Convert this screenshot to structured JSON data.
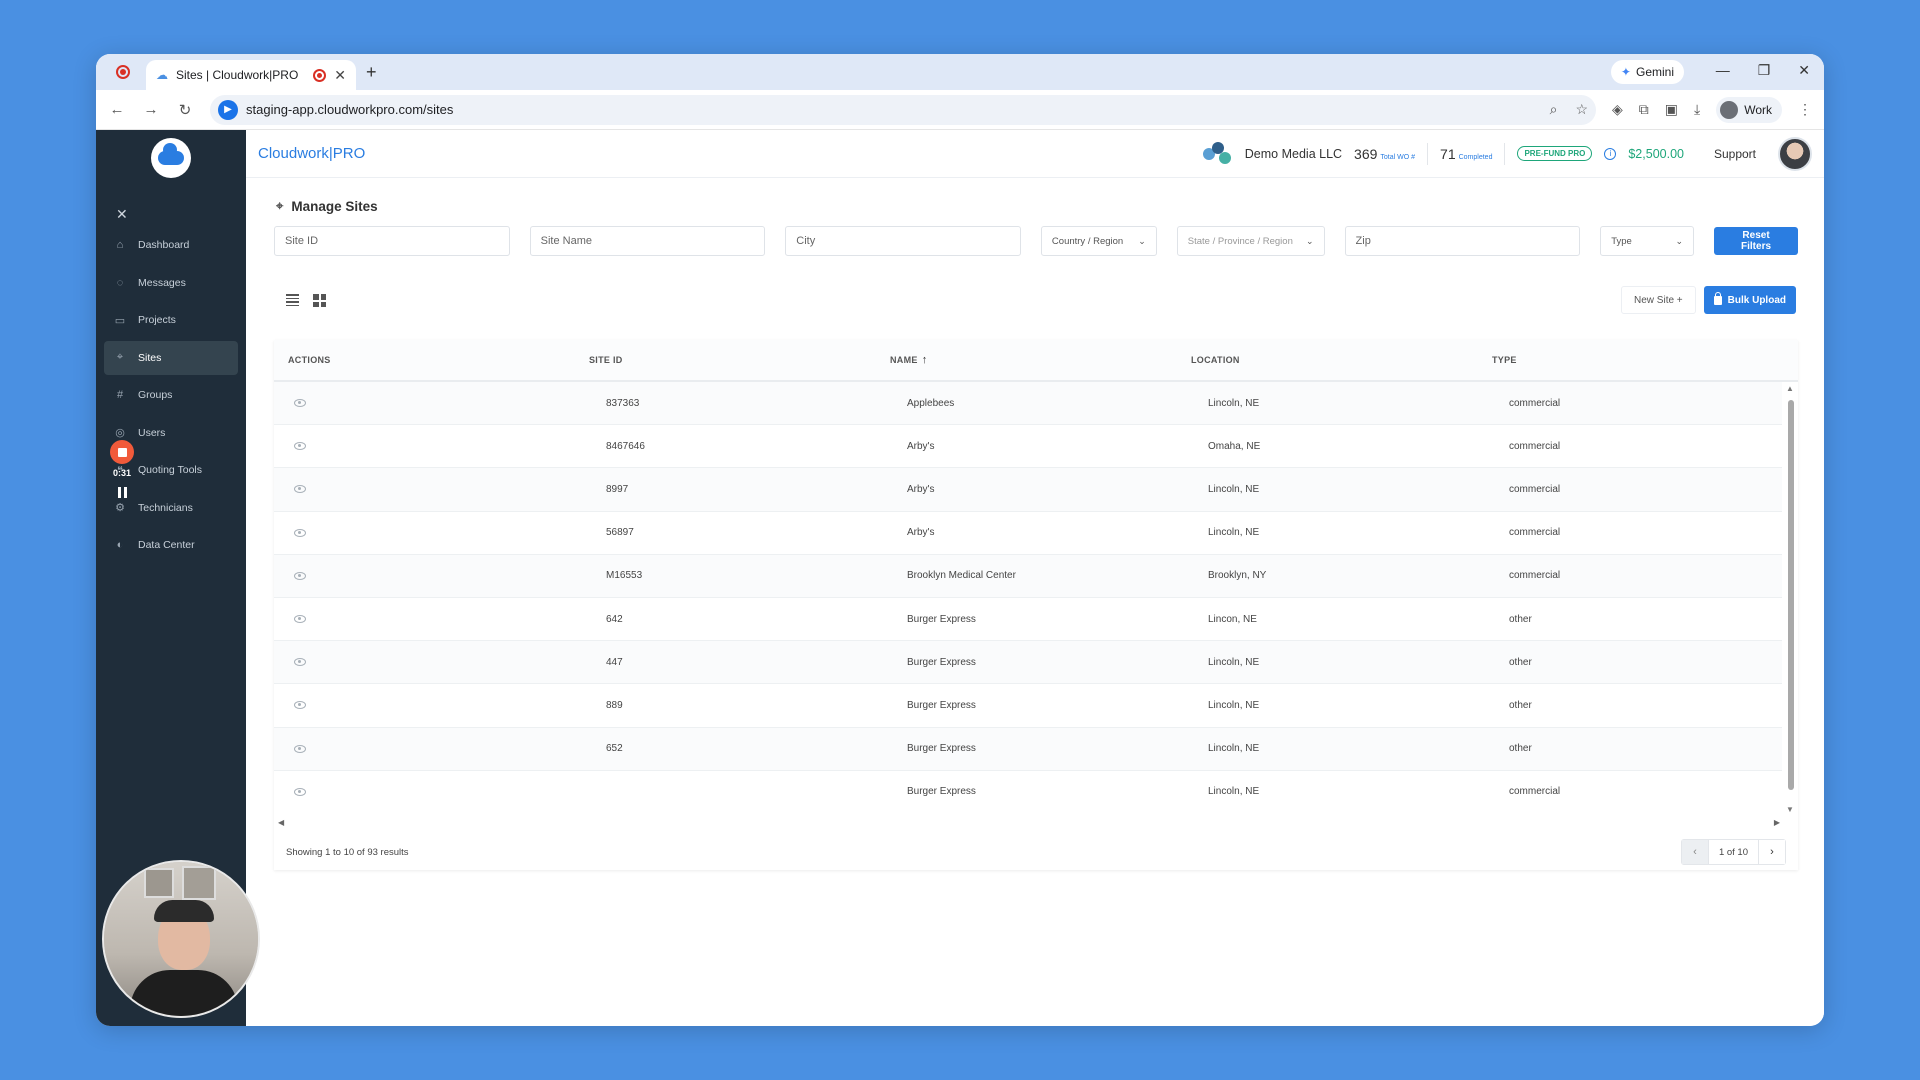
{
  "browser": {
    "tab_title": "Sites | Cloudwork|PRO",
    "new_tab": "+",
    "gemini_label": "Gemini",
    "url": "staging-app.cloudworkpro.com/sites",
    "profile_label": "Work"
  },
  "sidebar": {
    "items": [
      {
        "label": "Dashboard",
        "icon": "home-icon"
      },
      {
        "label": "Messages",
        "icon": "messages-icon"
      },
      {
        "label": "Projects",
        "icon": "folder-icon"
      },
      {
        "label": "Sites",
        "icon": "location-pin-icon"
      },
      {
        "label": "Groups",
        "icon": "hash-icon"
      },
      {
        "label": "Users",
        "icon": "users-icon"
      },
      {
        "label": "Quoting Tools",
        "icon": "quote-icon"
      },
      {
        "label": "Technicians",
        "icon": "technician-icon"
      },
      {
        "label": "Data Center",
        "icon": "data-center-icon"
      }
    ],
    "active": "Sites",
    "recording_time": "0:31"
  },
  "header": {
    "brand": "Cloudwork|PRO",
    "org_name": "Demo Media LLC",
    "total_wo": "369",
    "total_wo_label": "Total WO #",
    "completed": "71",
    "completed_label": "Completed",
    "plan_badge": "PRE-FUND PRO",
    "balance": "$2,500.00",
    "support": "Support"
  },
  "page": {
    "title": "Manage Sites",
    "filters": {
      "site_id_placeholder": "Site ID",
      "site_name_placeholder": "Site Name",
      "city_placeholder": "City",
      "country": "Country / Region",
      "state": "State / Province / Region",
      "zip_placeholder": "Zip",
      "type": "Type",
      "reset": "Reset Filters"
    },
    "new_site": "New Site +",
    "bulk_upload": "Bulk Upload"
  },
  "table": {
    "columns": [
      "ACTIONS",
      "SITE ID",
      "NAME",
      "LOCATION",
      "TYPE"
    ],
    "sort_arrow": "↑",
    "rows": [
      {
        "site_id": "837363",
        "name": "Applebees",
        "location": "Lincoln, NE",
        "type": "commercial"
      },
      {
        "site_id": "8467646",
        "name": "Arby's",
        "location": "Omaha, NE",
        "type": "commercial"
      },
      {
        "site_id": "8997",
        "name": "Arby's",
        "location": "Lincoln, NE",
        "type": "commercial"
      },
      {
        "site_id": "56897",
        "name": "Arby's",
        "location": "Lincoln, NE",
        "type": "commercial"
      },
      {
        "site_id": "M16553",
        "name": "Brooklyn Medical Center",
        "location": "Brooklyn, NY",
        "type": "commercial"
      },
      {
        "site_id": "642",
        "name": "Burger Express",
        "location": "Lincon, NE",
        "type": "other"
      },
      {
        "site_id": "447",
        "name": "Burger Express",
        "location": "Lincoln, NE",
        "type": "other"
      },
      {
        "site_id": "889",
        "name": "Burger Express",
        "location": "Lincoln, NE",
        "type": "other"
      },
      {
        "site_id": "652",
        "name": "Burger Express",
        "location": "Lincoln, NE",
        "type": "other"
      },
      {
        "site_id": "",
        "name": "Burger Express",
        "location": "Lincoln, NE",
        "type": "commercial"
      }
    ],
    "showing": "Showing 1 to 10 of 93 results",
    "page_info": "1 of 10"
  }
}
